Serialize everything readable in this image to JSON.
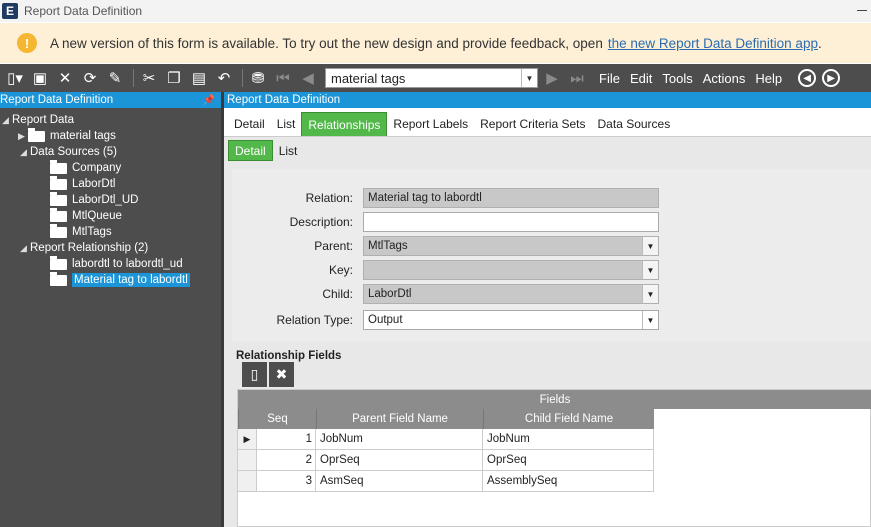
{
  "window": {
    "title": "Report Data Definition",
    "logo": "E"
  },
  "banner": {
    "text": "A new version of this form is available. To try out the new design and provide feedback, open",
    "link": "the new Report Data Definition app",
    "suffix": "."
  },
  "toolbar": {
    "nav_value": "material tags",
    "menu": [
      "File",
      "Edit",
      "Tools",
      "Actions",
      "Help"
    ]
  },
  "left_panel": {
    "title": "Report Data Definition",
    "tree": {
      "root": "Report Data",
      "material_tags": "material tags",
      "data_sources": "Data Sources (5)",
      "sources": [
        "Company",
        "LaborDtl",
        "LaborDtl_UD",
        "MtlQueue",
        "MtlTags"
      ],
      "report_relationship": "Report Relationship (2)",
      "relationships": [
        "labordtl to labordtl_ud",
        "Material tag to labordtl"
      ]
    }
  },
  "right_panel": {
    "title": "Report Data Definition",
    "tabs": [
      "Detail",
      "List",
      "Relationships",
      "Report Labels",
      "Report Criteria Sets",
      "Data Sources"
    ],
    "active_tab": "Relationships",
    "subtabs": [
      "Detail",
      "List"
    ],
    "active_subtab": "Detail",
    "form": {
      "relation_label": "Relation:",
      "relation": "Material tag to labordtl",
      "description_label": "Description:",
      "description": "",
      "parent_label": "Parent:",
      "parent": "MtlTags",
      "key_label": "Key:",
      "key": "",
      "child_label": "Child:",
      "child": "LaborDtl",
      "relation_type_label": "Relation Type:",
      "relation_type": "Output"
    },
    "fields": {
      "title": "Relationship Fields",
      "band": "Fields",
      "columns": [
        "Seq",
        "Parent Field Name",
        "Child Field Name"
      ],
      "rows": [
        {
          "seq": "1",
          "parent": "JobNum",
          "child": "JobNum"
        },
        {
          "seq": "2",
          "parent": "OprSeq",
          "child": "OprSeq"
        },
        {
          "seq": "3",
          "parent": "AsmSeq",
          "child": "AssemblySeq"
        }
      ]
    }
  }
}
